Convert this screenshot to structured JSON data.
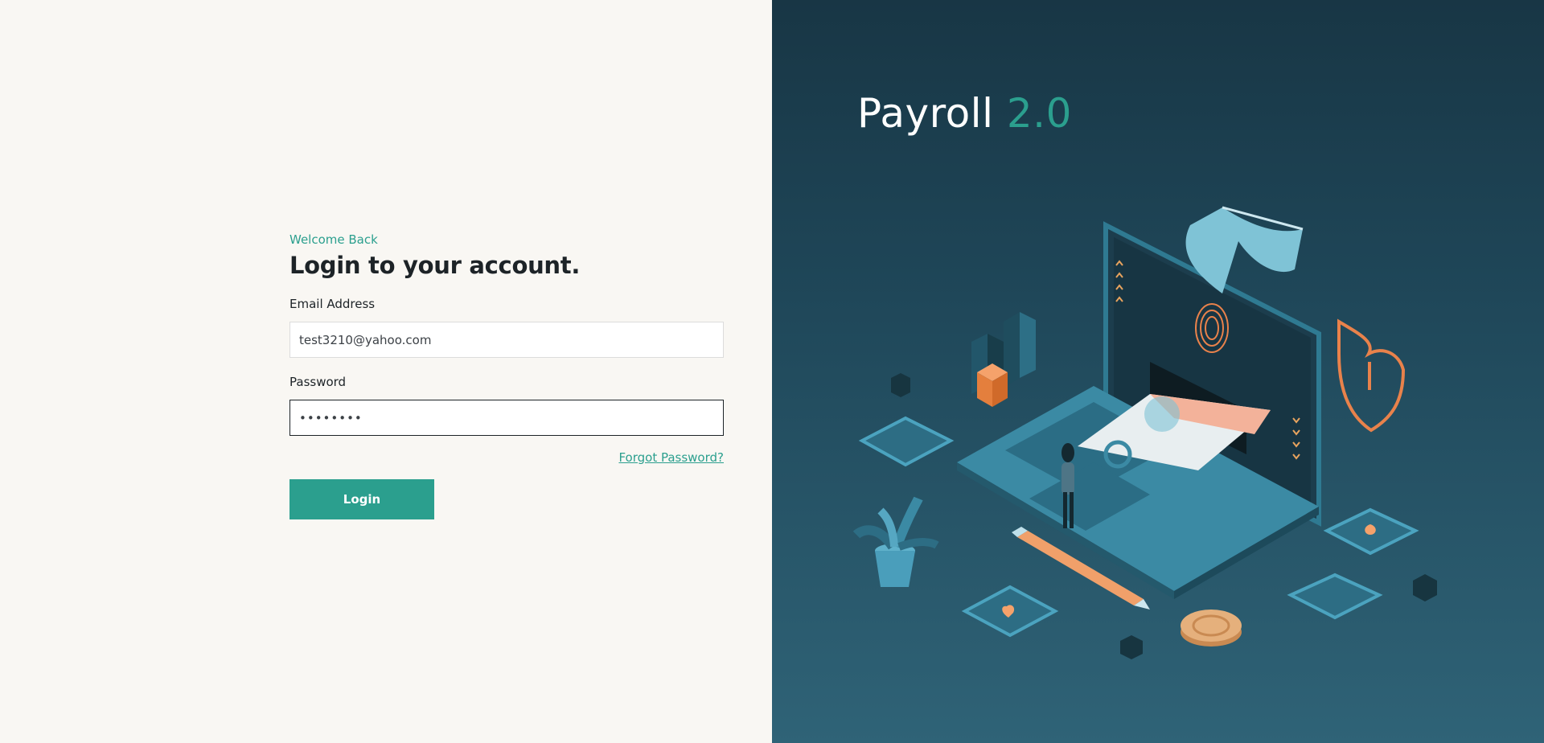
{
  "login": {
    "welcome": "Welcome Back",
    "title": "Login to your account.",
    "email_label": "Email Address",
    "email_value": "test3210@yahoo.com",
    "password_label": "Password",
    "password_value": "••••••••",
    "forgot_label": "Forgot Password?",
    "login_label": "Login"
  },
  "brand": {
    "name": "Payroll",
    "version": "2.0"
  },
  "colors": {
    "accent": "#2b9f8e",
    "panel_dark": "#183645",
    "orange": "#f08a4b"
  }
}
